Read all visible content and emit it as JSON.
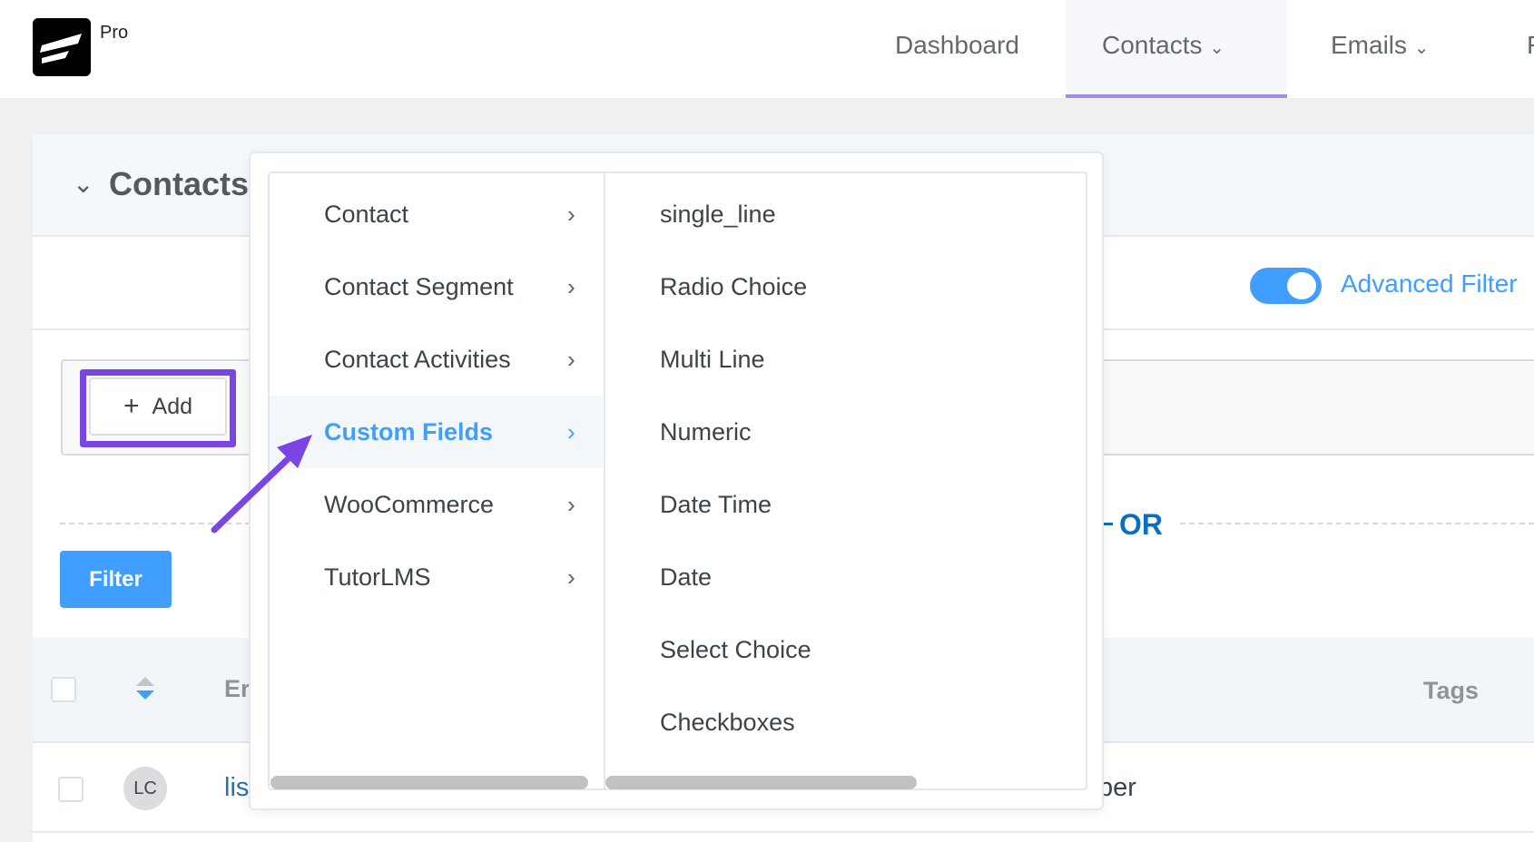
{
  "header": {
    "logo_text": "Pro",
    "nav": [
      {
        "label": "Dashboard"
      },
      {
        "label": "Contacts"
      },
      {
        "label": "Emails"
      },
      {
        "label": "F"
      }
    ],
    "active_tab": "Contacts"
  },
  "page": {
    "title": "Contacts",
    "advanced_filter_label": "Advanced Filter",
    "advanced_filter_on": true,
    "add_label": "Add",
    "or_label": "OR",
    "filter_label": "Filter"
  },
  "table": {
    "headers": {
      "email": "Er",
      "tags": "Tags"
    },
    "rows": [
      {
        "avatar": "LC",
        "email": "lis",
        "extra": "ber"
      }
    ]
  },
  "dropdown": {
    "categories": [
      {
        "label": "Contact"
      },
      {
        "label": "Contact Segment"
      },
      {
        "label": "Contact Activities"
      },
      {
        "label": "Custom Fields",
        "active": true
      },
      {
        "label": "WooCommerce"
      },
      {
        "label": "TutorLMS"
      }
    ],
    "fields": [
      {
        "label": "single_line"
      },
      {
        "label": "Radio Choice"
      },
      {
        "label": "Multi Line"
      },
      {
        "label": "Numeric"
      },
      {
        "label": "Date Time"
      },
      {
        "label": "Date"
      },
      {
        "label": "Select Choice"
      },
      {
        "label": "Checkboxes"
      }
    ]
  },
  "colors": {
    "accent": "#409eff",
    "highlight": "#7b45e3",
    "or": "#0a6fc2"
  }
}
